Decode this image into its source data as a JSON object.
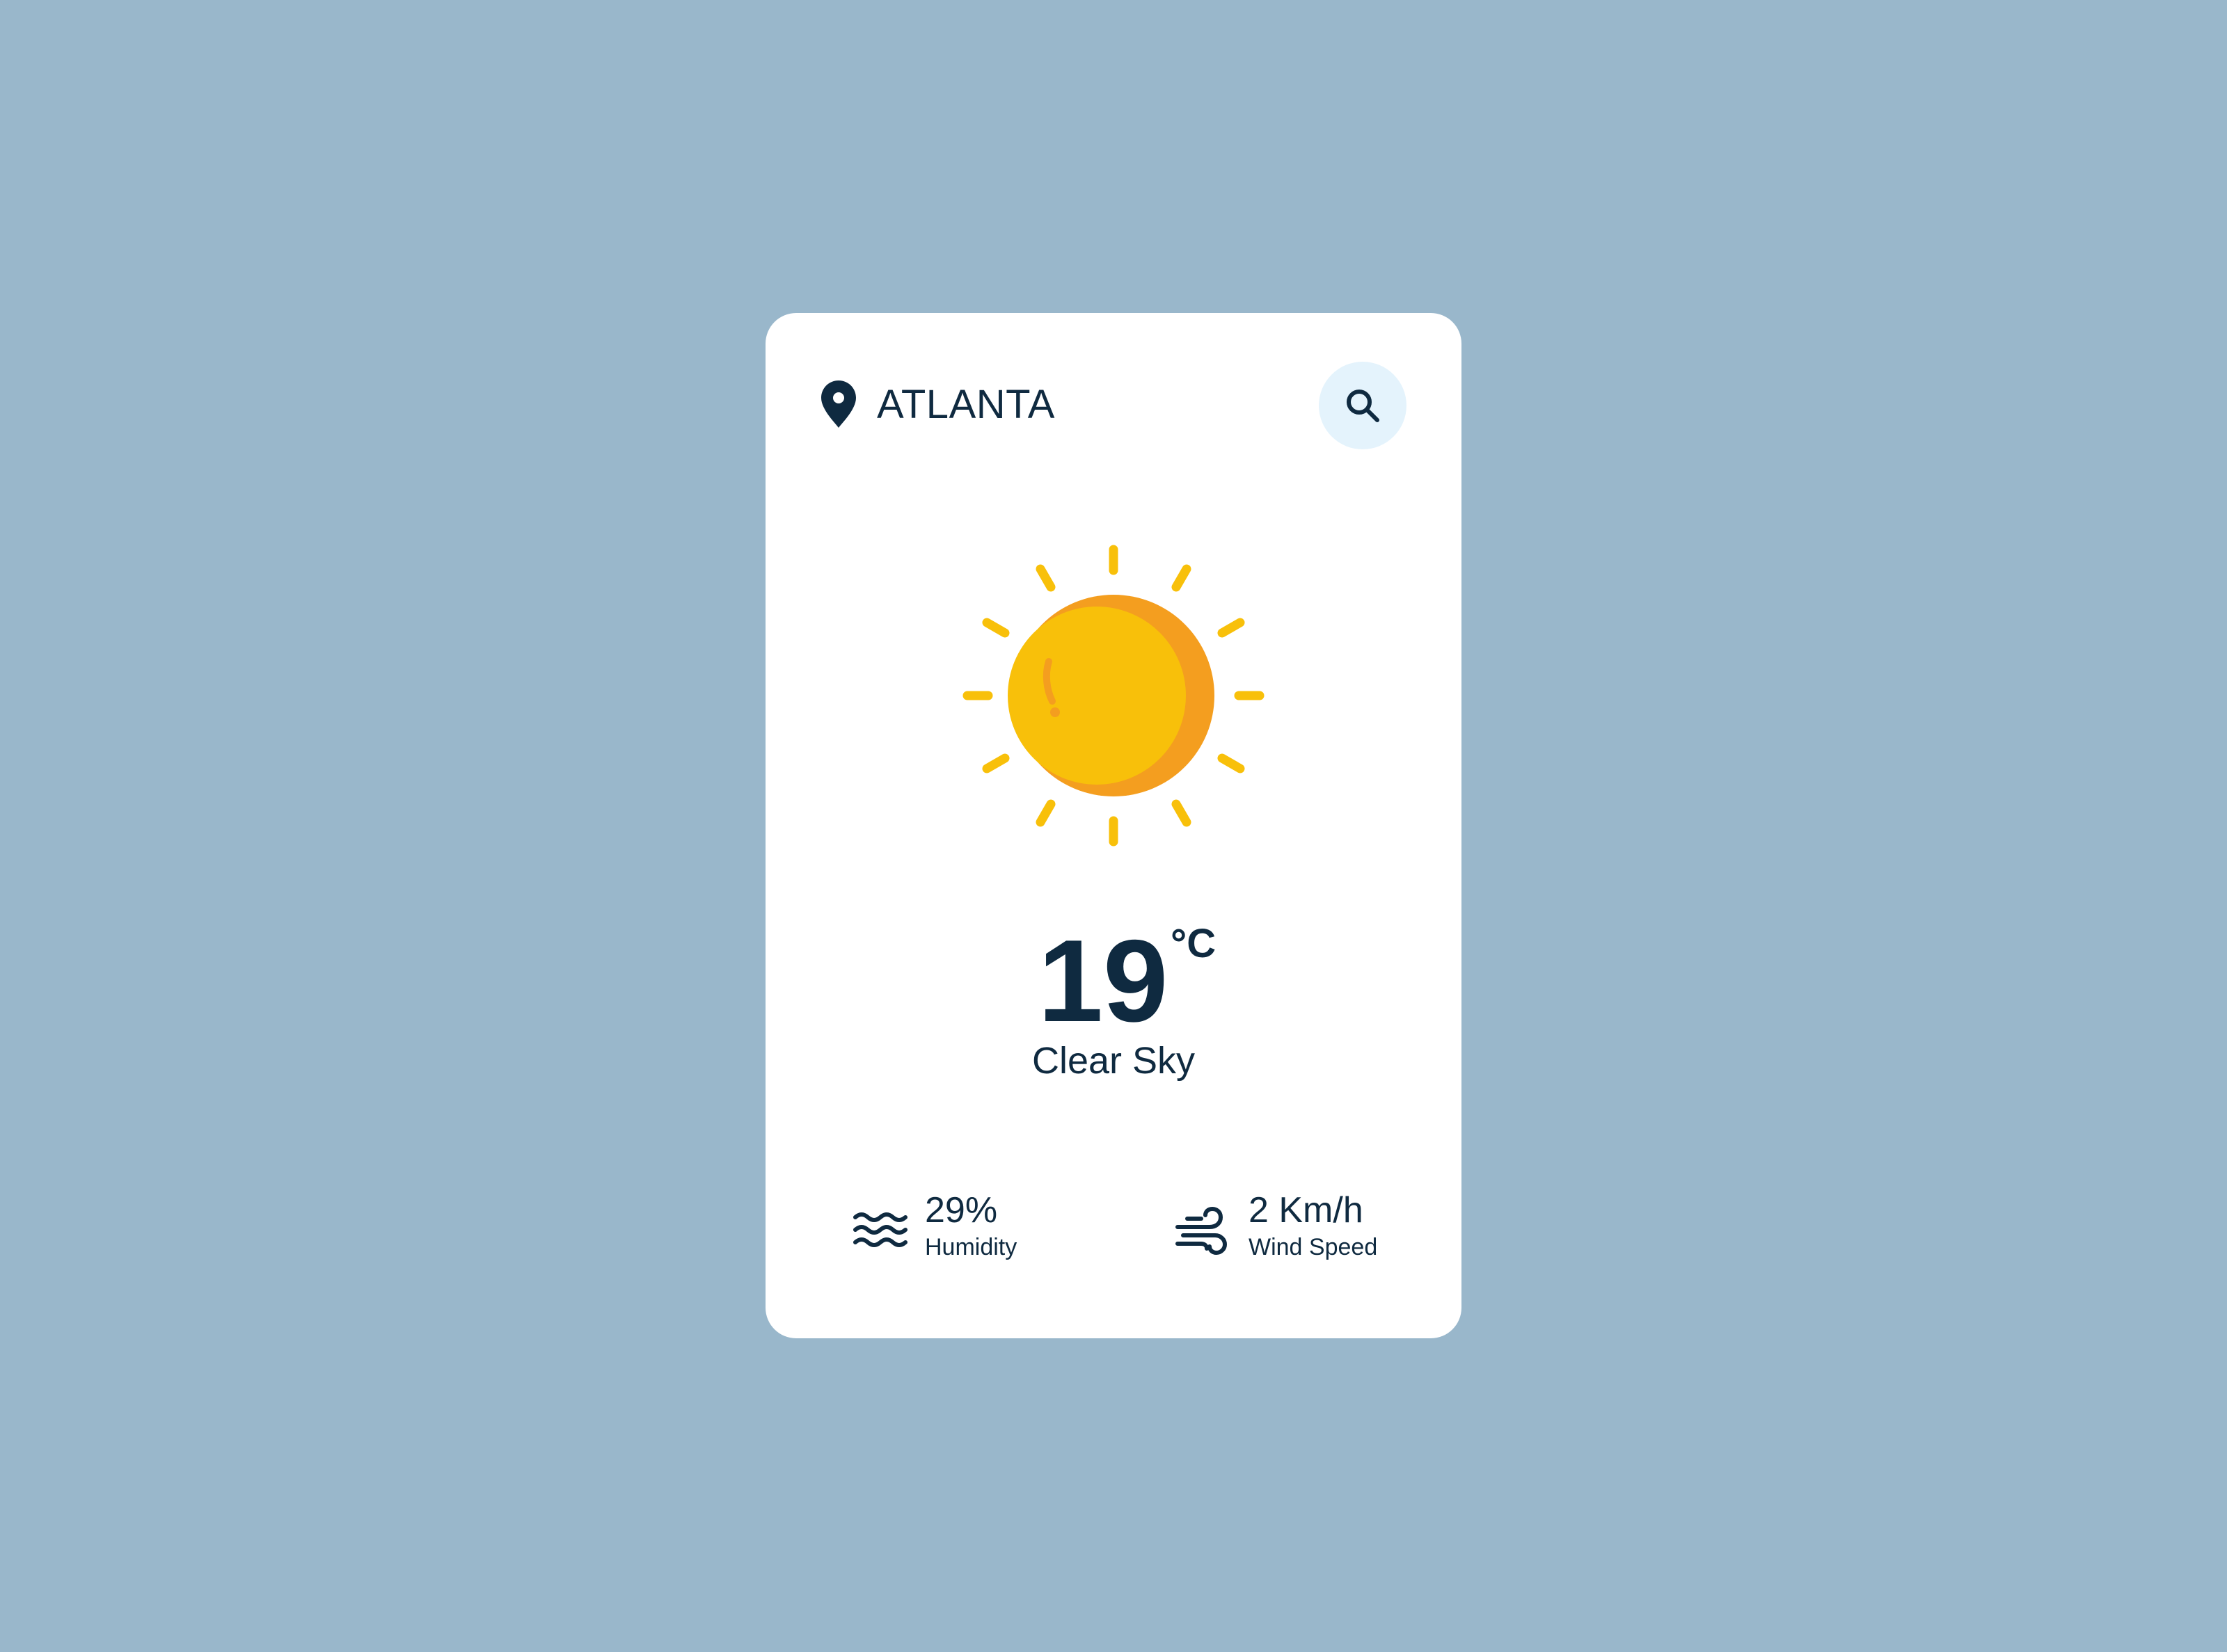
{
  "location": {
    "city": "ATLANTA",
    "icon": "location-pin-icon"
  },
  "search": {
    "icon": "search-icon"
  },
  "weather": {
    "icon": "sun-icon",
    "temperature": "19",
    "unit": "°C",
    "condition": "Clear Sky"
  },
  "stats": {
    "humidity": {
      "value": "29%",
      "label": "Humidity",
      "icon": "humidity-waves-icon"
    },
    "wind": {
      "value": "2 Km/h",
      "label": "Wind Speed",
      "icon": "wind-icon"
    }
  },
  "colors": {
    "background": "#99b7cb",
    "card": "#ffffff",
    "text": "#0f2a40",
    "search_button": "#e4f3fc",
    "sun": "#f8c00a",
    "sun_shade": "#f49e1f"
  }
}
